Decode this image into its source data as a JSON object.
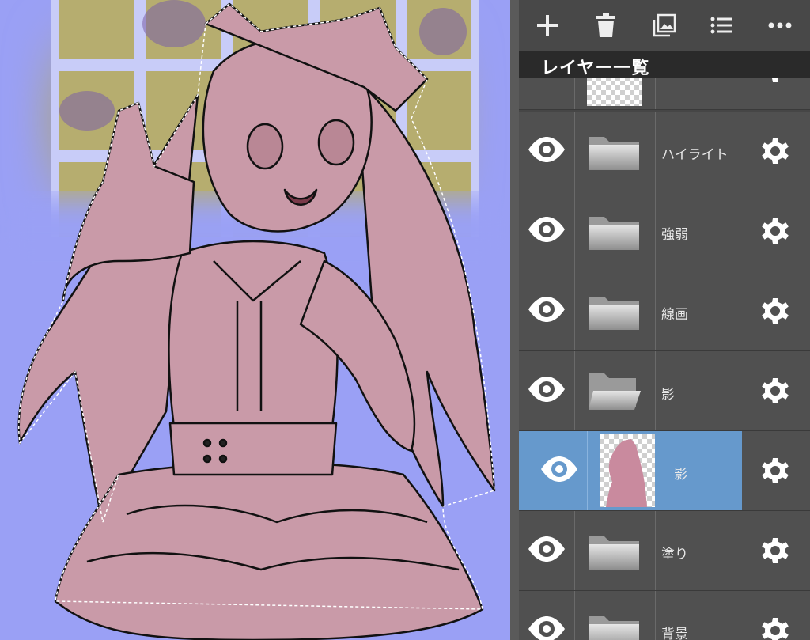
{
  "toolbar": {
    "buttons": [
      {
        "icon": "plus-icon"
      },
      {
        "icon": "trash-icon"
      },
      {
        "icon": "image-icon"
      },
      {
        "icon": "list-icon"
      },
      {
        "icon": "more-icon"
      }
    ]
  },
  "panel": {
    "title": "レイヤー一覧"
  },
  "layers": [
    {
      "name": "",
      "type": "layer",
      "visible": false
    },
    {
      "name": "ハイライト",
      "type": "folder",
      "visible": true
    },
    {
      "name": "強弱",
      "type": "folder",
      "visible": true
    },
    {
      "name": "線画",
      "type": "folder",
      "visible": true
    },
    {
      "name": "影",
      "type": "folder-open",
      "visible": true
    },
    {
      "name": "影",
      "type": "layer",
      "visible": true,
      "selected": true
    },
    {
      "name": "塗り",
      "type": "folder",
      "visible": true
    },
    {
      "name": "背景",
      "type": "folder",
      "visible": true
    }
  ],
  "colors": {
    "canvas_bg": "#9aa0f5",
    "selection_accent": "#6699cc",
    "fill_pink": "#c99aa8"
  }
}
